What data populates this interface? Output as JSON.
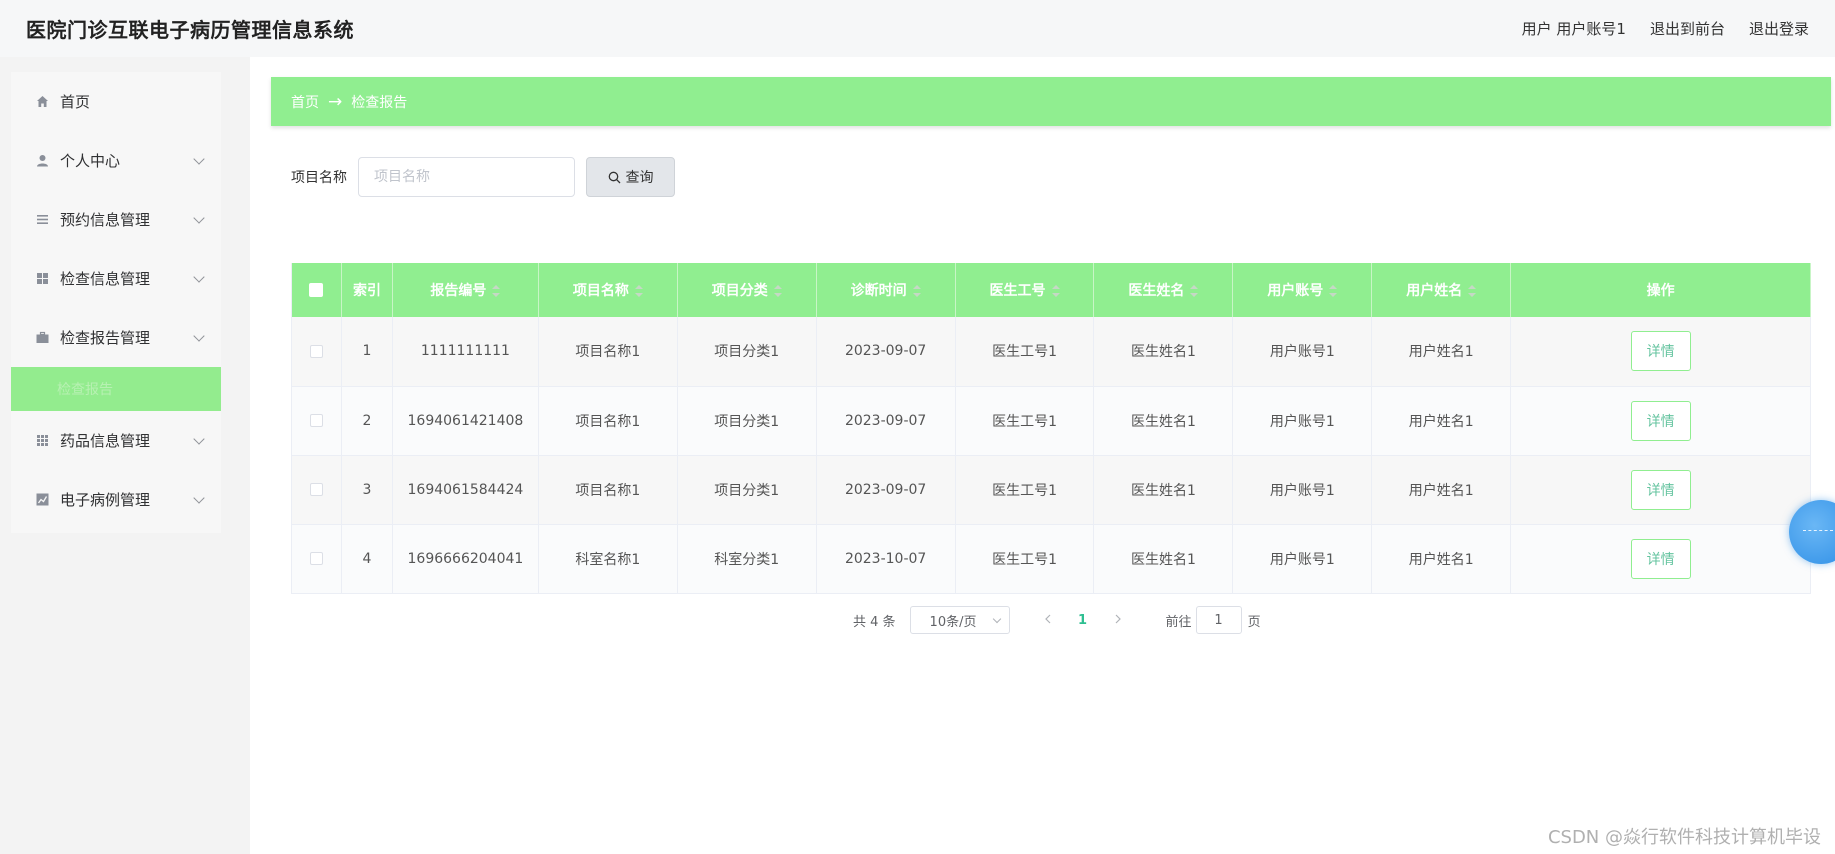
{
  "header": {
    "app_title": "医院门诊互联电子病历管理信息系统",
    "user_info": "用户 用户账号1",
    "back_to_front": "退出到前台",
    "logout": "退出登录"
  },
  "sidebar": {
    "items": [
      {
        "label": "首页",
        "icon": "home-icon"
      },
      {
        "label": "个人中心",
        "icon": "user-icon"
      },
      {
        "label": "预约信息管理",
        "icon": "list-icon"
      },
      {
        "label": "检查信息管理",
        "icon": "grid-icon"
      },
      {
        "label": "检查报告管理",
        "icon": "briefcase-icon"
      },
      {
        "label": "药品信息管理",
        "icon": "apps-icon"
      },
      {
        "label": "电子病例管理",
        "icon": "chart-icon"
      }
    ],
    "active_submenu": "检查报告"
  },
  "breadcrumb": {
    "home": "首页",
    "arrow": "→",
    "current": "检查报告"
  },
  "search": {
    "label": "项目名称",
    "placeholder": "项目名称",
    "button": "查询"
  },
  "table": {
    "headers": [
      "索引",
      "报告编号",
      "项目名称",
      "项目分类",
      "诊断时间",
      "医生工号",
      "医生姓名",
      "用户账号",
      "用户姓名",
      "操作"
    ],
    "rows": [
      {
        "index": "1",
        "report_no": "1111111111",
        "item_name": "项目名称1",
        "item_category": "项目分类1",
        "diag_time": "2023-09-07",
        "doctor_id": "医生工号1",
        "doctor_name": "医生姓名1",
        "user_account": "用户账号1",
        "user_name": "用户姓名1",
        "action": "详情"
      },
      {
        "index": "2",
        "report_no": "1694061421408",
        "item_name": "项目名称1",
        "item_category": "项目分类1",
        "diag_time": "2023-09-07",
        "doctor_id": "医生工号1",
        "doctor_name": "医生姓名1",
        "user_account": "用户账号1",
        "user_name": "用户姓名1",
        "action": "详情"
      },
      {
        "index": "3",
        "report_no": "1694061584424",
        "item_name": "项目名称1",
        "item_category": "项目分类1",
        "diag_time": "2023-09-07",
        "doctor_id": "医生工号1",
        "doctor_name": "医生姓名1",
        "user_account": "用户账号1",
        "user_name": "用户姓名1",
        "action": "详情"
      },
      {
        "index": "4",
        "report_no": "1696666204041",
        "item_name": "科室名称1",
        "item_category": "科室分类1",
        "diag_time": "2023-10-07",
        "doctor_id": "医生工号1",
        "doctor_name": "医生姓名1",
        "user_account": "用户账号1",
        "user_name": "用户姓名1",
        "action": "详情"
      }
    ]
  },
  "pagination": {
    "total": "共 4 条",
    "page_size": "10条/页",
    "current_page": "1",
    "goto_label": "前往",
    "goto_value": "1",
    "page_suffix": "页"
  },
  "watermark": "CSDN @焱行软件科技计算机毕设",
  "colors": {
    "accent": "#90ee90",
    "link": "#2ebf91"
  }
}
